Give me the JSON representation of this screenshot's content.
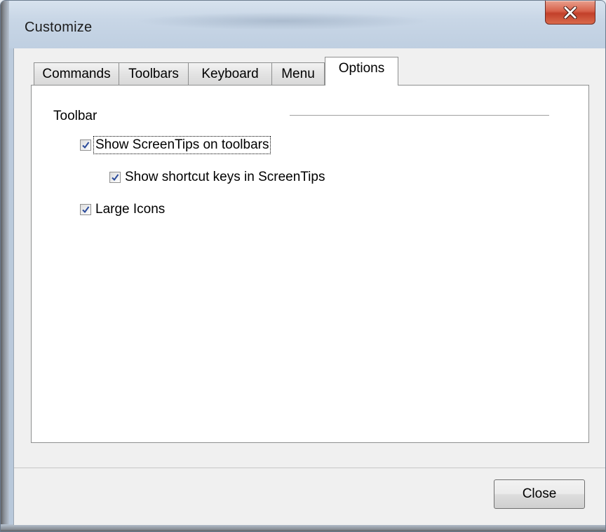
{
  "window": {
    "title": "Customize"
  },
  "tabs": [
    {
      "label": "Commands"
    },
    {
      "label": "Toolbars"
    },
    {
      "label": "Keyboard"
    },
    {
      "label": "Menu"
    },
    {
      "label": "Options",
      "active": true
    }
  ],
  "options": {
    "group_label": "Toolbar",
    "show_screentips": {
      "label": "Show ScreenTips on toolbars",
      "checked": true
    },
    "show_shortcut_keys": {
      "label": "Show shortcut keys in ScreenTips",
      "checked": true
    },
    "large_icons": {
      "label": "Large Icons",
      "checked": true
    }
  },
  "footer": {
    "close_label": "Close"
  },
  "colors": {
    "title_close_button": "#d7614a",
    "checkmark": "#2a4a9a"
  },
  "icons": {
    "window_close": "close-icon",
    "check": "checkmark-icon"
  }
}
